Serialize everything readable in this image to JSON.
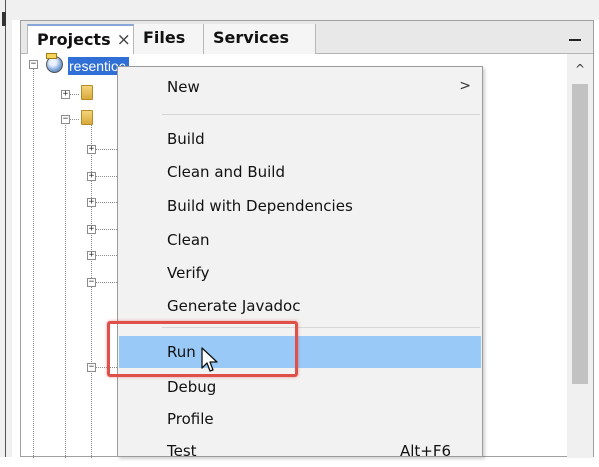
{
  "tabs": [
    {
      "label": "Projects",
      "close": "×"
    },
    {
      "label": "Files"
    },
    {
      "label": "Services"
    }
  ],
  "tree": {
    "project_label": "resentioc"
  },
  "scroll": {
    "up_glyph": "^"
  },
  "context_menu": {
    "items": [
      {
        "label": "New",
        "submenu_arrow": ">"
      },
      {
        "label": "Build"
      },
      {
        "label": "Clean and Build"
      },
      {
        "label": "Build with Dependencies"
      },
      {
        "label": "Clean"
      },
      {
        "label": "Verify"
      },
      {
        "label": "Generate Javadoc"
      },
      {
        "label": "Run",
        "highlighted": true
      },
      {
        "label": "Debug"
      },
      {
        "label": "Profile"
      },
      {
        "label": "Test",
        "accelerator": "Alt+F6"
      }
    ]
  },
  "colors": {
    "selection": "#2f6fd6",
    "menu_highlight": "#99c9f6",
    "callout": "#e0504a"
  },
  "icons": [
    "project-globe-icon",
    "folder-icon",
    "expand-icon",
    "collapse-icon",
    "mouse-cursor-icon",
    "minimize-icon"
  ]
}
